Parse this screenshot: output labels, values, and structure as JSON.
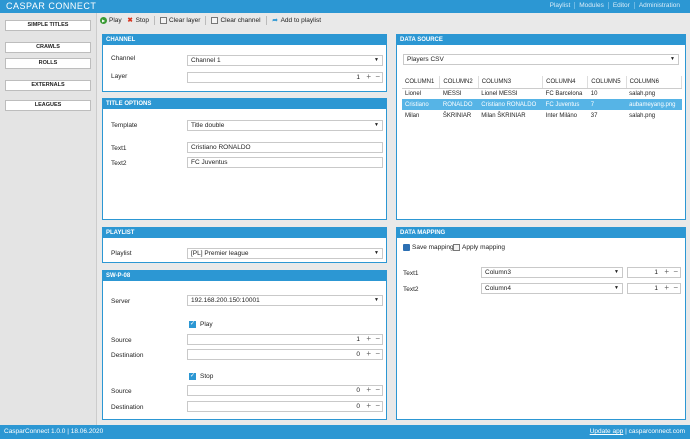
{
  "app": {
    "title": "CASPAR CONNECT"
  },
  "topnav": [
    "Playlist",
    "Modules",
    "Editor",
    "Administration"
  ],
  "sidebar": [
    "SIMPLE TITLES",
    "CRAWLS",
    "ROLLS",
    "EXTERNALS",
    "LEAGUES"
  ],
  "toolbar": {
    "play": "Play",
    "stop": "Stop",
    "clear_layer": "Clear layer",
    "clear_channel": "Clear channel",
    "add_to_playlist": "Add to playlist"
  },
  "channel": {
    "header": "CHANNEL",
    "channel_label": "Channel",
    "channel_value": "Channel 1",
    "layer_label": "Layer",
    "layer_value": "1"
  },
  "title_options": {
    "header": "TITLE OPTIONS",
    "template_label": "Template",
    "template_value": "Title double",
    "text1_label": "Text1",
    "text1_value": "Cristiano RONALDO",
    "text2_label": "Text2",
    "text2_value": "FC Juventus"
  },
  "playlist": {
    "header": "PLAYLIST",
    "label": "Playlist",
    "value": "[PL] Premier league"
  },
  "swp": {
    "header": "SW-P-08",
    "server_label": "Server",
    "server_value": "192.168.200.150:10001",
    "play_label": "Play",
    "play_source_label": "Source",
    "play_source_value": "1",
    "play_dest_label": "Destination",
    "play_dest_value": "0",
    "stop_label": "Stop",
    "stop_source_label": "Source",
    "stop_source_value": "0",
    "stop_dest_label": "Destination",
    "stop_dest_value": "0"
  },
  "datasource": {
    "header": "DATA SOURCE",
    "source_value": "Players CSV",
    "columns": [
      "COLUMN1",
      "COLUMN2",
      "COLUMN3",
      "COLUMN4",
      "COLUMN5",
      "COLUMN6"
    ],
    "rows": [
      [
        "Lionel",
        "MESSI",
        "Lionel MESSI",
        "FC Barcelona",
        "10",
        "salah.png"
      ],
      [
        "Cristiano",
        "RONALDO",
        "Cristiano RONALDO",
        "FC Juventus",
        "7",
        "aubameyang.png"
      ],
      [
        "Milan",
        "ŠKRINIAR",
        "Milan ŠKRINIAR",
        "Inter Miláno",
        "37",
        "salah.png"
      ]
    ]
  },
  "datamapping": {
    "header": "DATA MAPPING",
    "save_label": "Save mapping",
    "apply_label": "Apply mapping",
    "rows": [
      {
        "label": "Text1",
        "column": "Column3",
        "value": "1"
      },
      {
        "label": "Text2",
        "column": "Column4",
        "value": "1"
      }
    ]
  },
  "status": {
    "version": "CasparConnect 1.0.0",
    "date": "18.06.2020",
    "update": "Update app",
    "site": "casparconnect.com"
  },
  "colors": {
    "accent": "#2c97d3",
    "selected_row": "#56b4e6"
  }
}
